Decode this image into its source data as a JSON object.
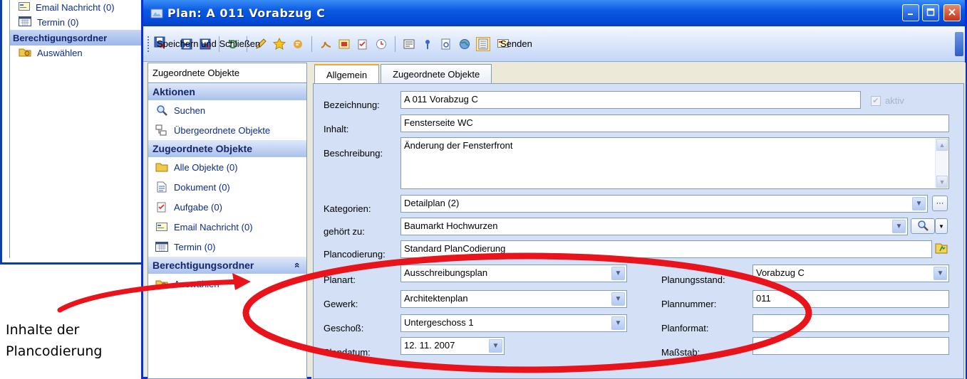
{
  "background_window": {
    "items": [
      {
        "label": "Email Nachricht (0)",
        "icon": "email-icon"
      },
      {
        "label": "Termin (0)",
        "icon": "calendar-icon"
      }
    ],
    "section": "Berechtigungsordner",
    "action": {
      "label": "Auswählen",
      "icon": "select-folder-icon"
    }
  },
  "window": {
    "title": "Plan: A 011 Vorabzug C",
    "controls": [
      "minimize",
      "maximize",
      "close"
    ]
  },
  "toolbar": {
    "save_close_label": "Speichern und Schließen",
    "send_label": "Senden"
  },
  "nav": {
    "header": "Zugeordnete Objekte",
    "aktionen": {
      "title": "Aktionen",
      "items": [
        {
          "label": "Suchen",
          "icon": "search-icon"
        },
        {
          "label": "Übergeordnete Objekte",
          "icon": "parent-objects-icon"
        }
      ]
    },
    "zugeordnete": {
      "title": "Zugeordnete Objekte",
      "items": [
        {
          "label": "Alle Objekte (0)",
          "icon": "folder-icon"
        },
        {
          "label": "Dokument (0)",
          "icon": "document-icon"
        },
        {
          "label": "Aufgabe (0)",
          "icon": "task-icon"
        },
        {
          "label": "Email Nachricht (0)",
          "icon": "email-icon"
        },
        {
          "label": "Termin (0)",
          "icon": "calendar-icon"
        }
      ]
    },
    "berechtigung": {
      "title": "Berechtigungsordner",
      "collapse_glyph": "«",
      "items": [
        {
          "label": "Auswählen",
          "icon": "select-folder-icon"
        }
      ]
    }
  },
  "tabs": [
    {
      "label": "Allgemein",
      "active": true
    },
    {
      "label": "Zugeordnete Objekte",
      "active": false
    }
  ],
  "form": {
    "bezeichnung": {
      "label": "Bezeichnung:",
      "value": "A 011 Vorabzug C"
    },
    "aktiv": {
      "label": "aktiv",
      "checked": true
    },
    "inhalt": {
      "label": "Inhalt:",
      "value": "Fensterseite WC"
    },
    "beschreibung": {
      "label": "Beschreibung:",
      "value": "Änderung der Fensterfront"
    },
    "kategorien": {
      "label": "Kategorien:",
      "value": "Detailplan (2)"
    },
    "gehoert_zu": {
      "label": "gehört zu:",
      "value": "Baumarkt Hochwurzen"
    },
    "plancodierung": {
      "label": "Plancodierung:",
      "value": "Standard PlanCodierung"
    },
    "planart": {
      "label": "Planart:",
      "value": "Ausschreibungsplan"
    },
    "gewerk": {
      "label": "Gewerk:",
      "value": "Architektenplan"
    },
    "geschoss": {
      "label": "Geschoß:",
      "value": "Untergeschoss 1"
    },
    "plandatum": {
      "label": "Plandatum:",
      "value": "12. 11. 2007"
    },
    "planungsstand": {
      "label": "Planungsstand:",
      "value": "Vorabzug C"
    },
    "plannummer": {
      "label": "Plannummer:",
      "value": "011"
    },
    "planformat": {
      "label": "Planformat:",
      "value": ""
    },
    "massstab": {
      "label": "Maßstab:",
      "value": ""
    }
  },
  "annotation": {
    "line1": "Inhalte der",
    "line2": "Plancodierung",
    "color": "#e8131b"
  },
  "colors": {
    "titlebar": "#0a5ae1",
    "panel": "#d3e0f5",
    "nav_section_text": "#16256e",
    "link": "#0b2c8c"
  }
}
